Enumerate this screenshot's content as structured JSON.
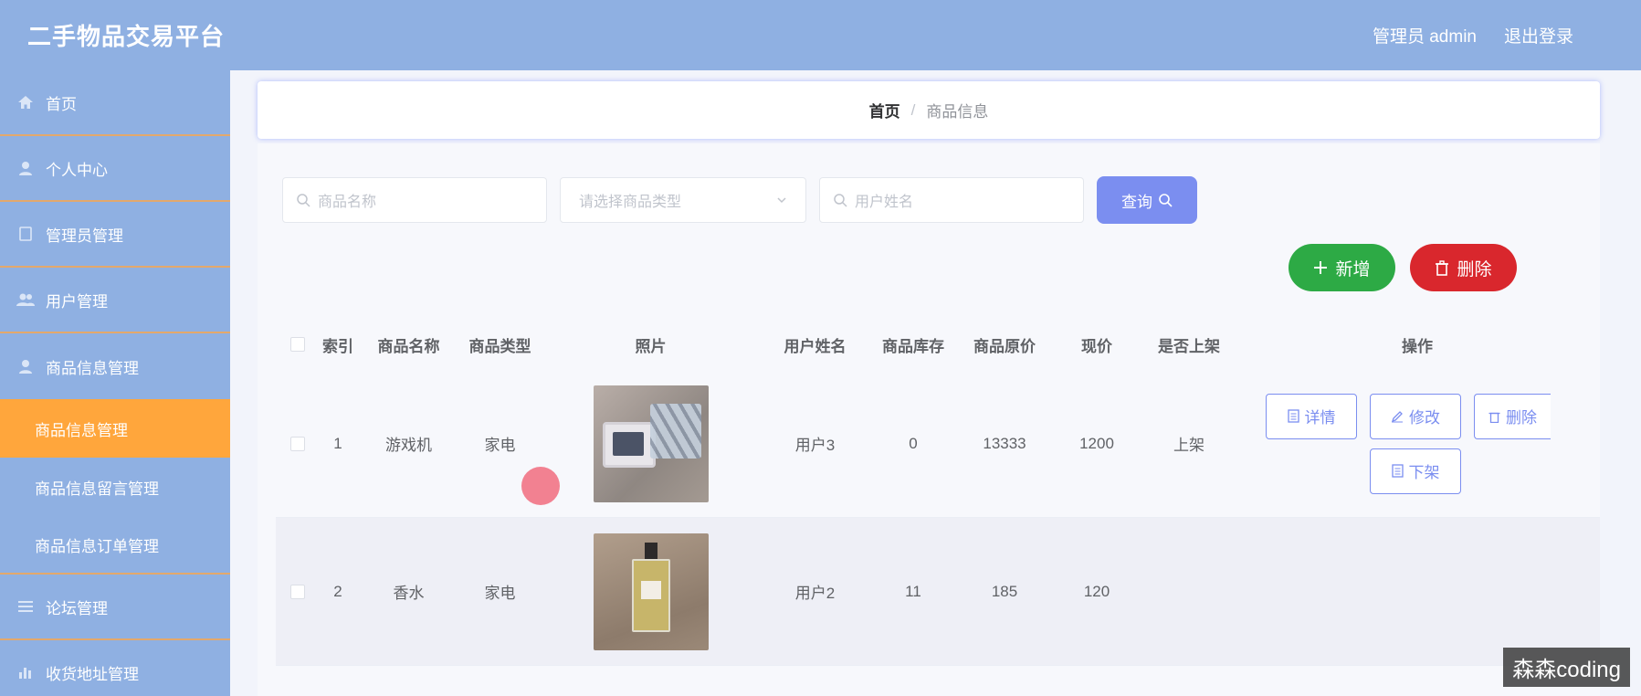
{
  "header": {
    "title": "二手物品交易平台",
    "user_label": "管理员 admin",
    "logout_label": "退出登录"
  },
  "sidebar": {
    "items": [
      {
        "label": "首页",
        "icon": "home-icon"
      },
      {
        "label": "个人中心",
        "icon": "user-icon"
      },
      {
        "label": "管理员管理",
        "icon": "document-icon"
      },
      {
        "label": "用户管理",
        "icon": "users-icon"
      },
      {
        "label": "商品信息管理",
        "icon": "user-icon"
      }
    ],
    "sub_items": [
      {
        "label": "商品信息管理",
        "active": true
      },
      {
        "label": "商品信息留言管理",
        "active": false
      },
      {
        "label": "商品信息订单管理",
        "active": false
      }
    ],
    "items_after": [
      {
        "label": "论坛管理",
        "icon": "list-icon"
      },
      {
        "label": "收货地址管理",
        "icon": "chart-icon"
      }
    ]
  },
  "breadcrumb": {
    "home": "首页",
    "separator": "/",
    "current": "商品信息"
  },
  "search": {
    "name_placeholder": "商品名称",
    "type_placeholder": "请选择商品类型",
    "user_placeholder": "用户姓名",
    "query_label": "查询"
  },
  "actions": {
    "add_label": "新增",
    "delete_label": "删除"
  },
  "table": {
    "columns": [
      "索引",
      "商品名称",
      "商品类型",
      "照片",
      "用户姓名",
      "商品库存",
      "商品原价",
      "现价",
      "是否上架",
      "操作"
    ],
    "rows": [
      {
        "index": "1",
        "name": "游戏机",
        "type": "家电",
        "user": "用户3",
        "stock": "0",
        "original_price": "13333",
        "price": "1200",
        "on_shelf": "上架"
      },
      {
        "index": "2",
        "name": "香水",
        "type": "家电",
        "user": "用户2",
        "stock": "11",
        "original_price": "185",
        "price": "120",
        "on_shelf": ""
      }
    ],
    "op_labels": {
      "detail": "详情",
      "edit": "修改",
      "delete": "删除",
      "unshelf": "下架"
    }
  },
  "watermark": "森森coding",
  "colors": {
    "header_bg": "#8fb0e2",
    "sidebar_active": "#ffa63c",
    "primary": "#7b8ef0",
    "success": "#2daa45",
    "danger": "#d9272d"
  }
}
